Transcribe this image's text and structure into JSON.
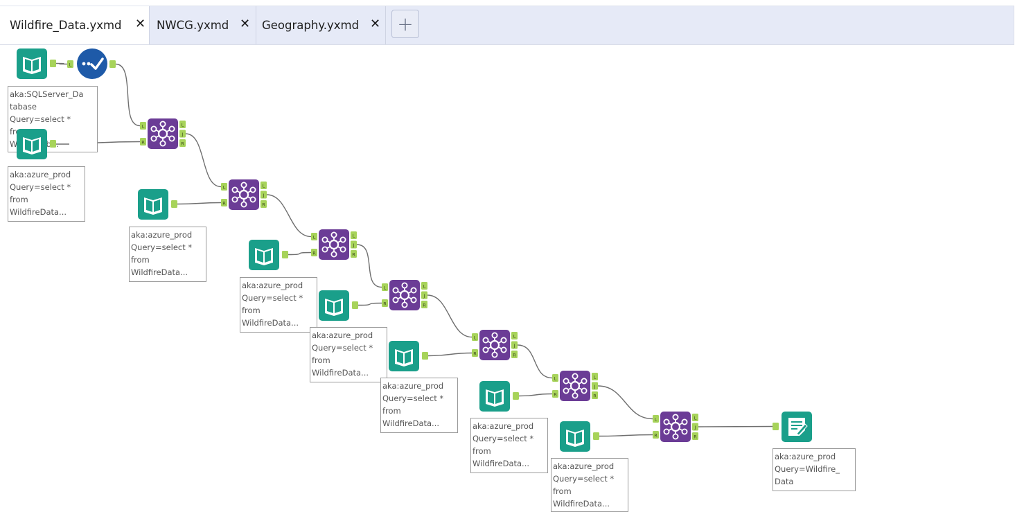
{
  "tabs": [
    {
      "label": "Wildfire_Data.yxmd",
      "close": "✕",
      "active": true
    },
    {
      "label": "NWCG.yxmd",
      "close": "✕",
      "active": false
    },
    {
      "label": "Geography.yxmd",
      "close": "✕",
      "active": false
    }
  ],
  "add_tab_label": "+",
  "anchors": {
    "left": "L",
    "join": "J",
    "right": "R"
  },
  "icons": {
    "input": "book-input-icon",
    "dynamic_input": "checkmark-dynamic-input-icon",
    "join": "join-network-icon",
    "output": "output-document-icon"
  },
  "colors": {
    "input_tool": "#1a9f8a",
    "dynamic_input_tool": "#1e5aa8",
    "join_tool": "#6b3c96",
    "anchor": "#a7d35a",
    "connector": "#6f6f6f",
    "tab_bar": "#e6eaf7"
  },
  "annotations": {
    "sqlserver": "aka:SQLServer_Da\ntabase\nQuery=select *\nfrom\nWildfireDb...",
    "azure_input": "aka:azure_prod\nQuery=select *\nfrom\nWildfireData...",
    "output": "aka:azure_prod\nQuery=Wildfire_\nData"
  }
}
